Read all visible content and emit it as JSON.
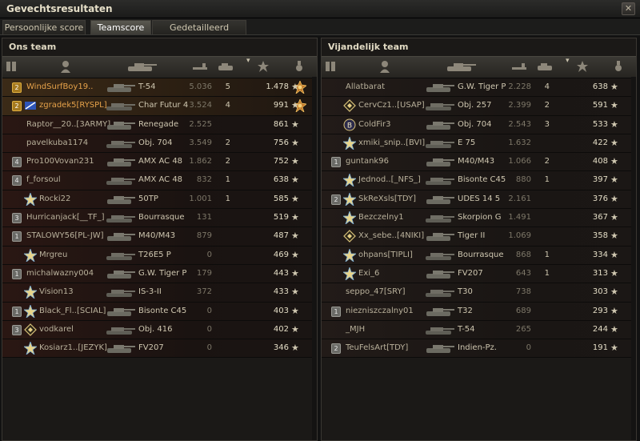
{
  "window": {
    "title": "Gevechtsresultaten",
    "close_icon": "close-icon"
  },
  "tabs": [
    {
      "label": "Persoonlijke score",
      "active": false
    },
    {
      "label": "Teamscore",
      "active": true
    },
    {
      "label": "Gedetailleerd rapport",
      "active": false
    }
  ],
  "colors": {
    "accent_gold": "#e6a24a",
    "ally_tint": "#2a1713",
    "enemy_tint": "#221b18"
  },
  "left_team": {
    "title": "Ons team",
    "rows": [
      {
        "platoon": "2",
        "mark": "",
        "name": "WindSurfBoy19..",
        "vehicle": "T-54",
        "damage": "5.036",
        "kills": "5",
        "xp": "1.478",
        "medal": true,
        "highlight": true,
        "gold": true
      },
      {
        "platoon": "2",
        "mark": "clan",
        "name": "zgradek5[RYSPL]",
        "vehicle": "Char Futur 4",
        "damage": "3.524",
        "kills": "4",
        "xp": "991",
        "medal": true,
        "highlight": true,
        "gold": true
      },
      {
        "platoon": "",
        "mark": "",
        "name": "Raptor__20..[3ARMY]",
        "vehicle": "Renegade",
        "damage": "2.525",
        "kills": "",
        "xp": "861",
        "medal": false
      },
      {
        "platoon": "",
        "mark": "",
        "name": "pavelkuba1174",
        "vehicle": "Obj. 704",
        "damage": "3.549",
        "kills": "2",
        "xp": "756",
        "medal": false
      },
      {
        "platoon": "4",
        "mark": "",
        "name": "Pro100Vovan231",
        "vehicle": "AMX AC 48",
        "damage": "1.862",
        "kills": "2",
        "xp": "752",
        "medal": false
      },
      {
        "platoon": "4",
        "mark": "",
        "name": "f_forsoul",
        "vehicle": "AMX AC 48",
        "damage": "832",
        "kills": "1",
        "xp": "638",
        "medal": false
      },
      {
        "platoon": "",
        "mark": "star",
        "name": "Rocki22",
        "vehicle": "50TP",
        "damage": "1.001",
        "kills": "1",
        "xp": "585",
        "medal": false
      },
      {
        "platoon": "3",
        "mark": "",
        "name": "Hurricanjack[__TF_]",
        "vehicle": "Bourrasque",
        "damage": "131",
        "kills": "",
        "xp": "519",
        "medal": false
      },
      {
        "platoon": "1",
        "mark": "",
        "name": "STALOWY56[PL-JW]",
        "vehicle": "M40/M43",
        "damage": "879",
        "kills": "",
        "xp": "487",
        "medal": false
      },
      {
        "platoon": "",
        "mark": "star",
        "name": "Mrgreu",
        "vehicle": "T26E5 P",
        "damage": "0",
        "kills": "",
        "xp": "469",
        "medal": false
      },
      {
        "platoon": "1",
        "mark": "",
        "name": "michalwazny004",
        "vehicle": "G.W. Tiger P",
        "damage": "179",
        "kills": "",
        "xp": "443",
        "medal": false
      },
      {
        "platoon": "",
        "mark": "star",
        "name": "Vision13",
        "vehicle": "IS-3-II",
        "damage": "372",
        "kills": "",
        "xp": "433",
        "medal": false
      },
      {
        "platoon": "1",
        "mark": "star",
        "name": "Black_Fl..[SCIAL]",
        "vehicle": "Bisonte C45",
        "damage": "0",
        "kills": "",
        "xp": "403",
        "medal": false
      },
      {
        "platoon": "3",
        "mark": "diamond",
        "name": "vodkarel",
        "vehicle": "Obj. 416",
        "damage": "0",
        "kills": "",
        "xp": "402",
        "medal": false
      },
      {
        "platoon": "",
        "mark": "star",
        "name": "Kosiarz1..[JEZYK]",
        "vehicle": "FV207",
        "damage": "0",
        "kills": "",
        "xp": "346",
        "medal": false
      }
    ]
  },
  "right_team": {
    "title": "Vijandelijk team",
    "rows": [
      {
        "platoon": "",
        "mark": "",
        "name": "Allatbarat",
        "vehicle": "G.W. Tiger P",
        "damage": "2.228",
        "kills": "4",
        "xp": "638",
        "medal": false
      },
      {
        "platoon": "",
        "mark": "diamond",
        "name": "CervCz1..[USAP]",
        "vehicle": "Obj. 257",
        "damage": "2.399",
        "kills": "2",
        "xp": "591",
        "medal": false
      },
      {
        "platoon": "",
        "mark": "b",
        "name": "ColdFir3",
        "vehicle": "Obj. 704",
        "damage": "2.543",
        "kills": "3",
        "xp": "533",
        "medal": false
      },
      {
        "platoon": "",
        "mark": "star",
        "name": "xmiki_snip..[BVI]",
        "vehicle": "E 75",
        "damage": "1.632",
        "kills": "",
        "xp": "422",
        "medal": false
      },
      {
        "platoon": "1",
        "mark": "",
        "name": "guntank96",
        "vehicle": "M40/M43",
        "damage": "1.066",
        "kills": "2",
        "xp": "408",
        "medal": false
      },
      {
        "platoon": "",
        "mark": "star",
        "name": "Jednod..[_NFS_]",
        "vehicle": "Bisonte C45",
        "damage": "880",
        "kills": "1",
        "xp": "397",
        "medal": false
      },
      {
        "platoon": "2",
        "mark": "star",
        "name": "SkReXsls[TDY]",
        "vehicle": "UDES 14 5",
        "damage": "2.161",
        "kills": "",
        "xp": "376",
        "medal": false
      },
      {
        "platoon": "",
        "mark": "star",
        "name": "Bezczelny1",
        "vehicle": "Skorpion G",
        "damage": "1.491",
        "kills": "",
        "xp": "367",
        "medal": false
      },
      {
        "platoon": "",
        "mark": "diamond",
        "name": "Xx_sebe..[4NIKI]",
        "vehicle": "Tiger II",
        "damage": "1.069",
        "kills": "",
        "xp": "358",
        "medal": false
      },
      {
        "platoon": "",
        "mark": "star",
        "name": "ohpans[TIPLI]",
        "vehicle": "Bourrasque",
        "damage": "868",
        "kills": "1",
        "xp": "334",
        "medal": false
      },
      {
        "platoon": "",
        "mark": "star",
        "name": "Exi_6",
        "vehicle": "FV207",
        "damage": "643",
        "kills": "1",
        "xp": "313",
        "medal": false
      },
      {
        "platoon": "",
        "mark": "",
        "name": "seppo_47[SRY]",
        "vehicle": "T30",
        "damage": "738",
        "kills": "",
        "xp": "303",
        "medal": false
      },
      {
        "platoon": "1",
        "mark": "",
        "name": "niezniszczalny01",
        "vehicle": "T32",
        "damage": "689",
        "kills": "",
        "xp": "293",
        "medal": false
      },
      {
        "platoon": "",
        "mark": "",
        "name": "_MJH",
        "vehicle": "T-54",
        "damage": "265",
        "kills": "",
        "xp": "244",
        "medal": false
      },
      {
        "platoon": "2",
        "mark": "",
        "name": "TeuFelsArt[TDY]",
        "vehicle": "Indien-Pz.",
        "damage": "0",
        "kills": "",
        "xp": "191",
        "medal": false
      }
    ]
  }
}
